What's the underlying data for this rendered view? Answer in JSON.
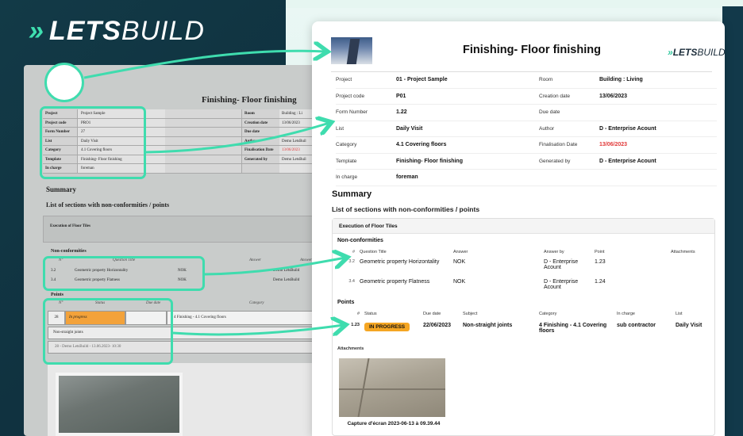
{
  "brand": {
    "chevrons": "»",
    "lets": "LETS",
    "build": "BUILD"
  },
  "old_doc": {
    "title": "Finishing- Floor finishing",
    "info_rows": [
      {
        "k": "Project",
        "v": "Project Sample",
        "k2": "Room",
        "v2": "Building : Li"
      },
      {
        "k": "Project code",
        "v": "PRO1",
        "k2": "Creation date",
        "v2": "13/06/2023"
      },
      {
        "k": "Form Number",
        "v": "27",
        "k2": "Due date",
        "v2": ""
      },
      {
        "k": "List",
        "v": "Daily Visit",
        "k2": "Author",
        "v2": "Demo LetsBuil"
      },
      {
        "k": "Category",
        "v": "4.1 Covering floors",
        "k2": "Finalisation Date",
        "v2": "13/06/2023"
      },
      {
        "k": "Template",
        "v": "Finishing- Floor finishing",
        "k2": "Generated by",
        "v2": "Demo LetsBuil"
      },
      {
        "k": "In charge",
        "v": "foreman",
        "k2": "",
        "v2": ""
      }
    ],
    "summary": "Summary",
    "list_heading": "List of sections with non-conformities / points",
    "section": "Execution of Floor Tiles",
    "nc_heading": "Non-conformities",
    "nc_cols": [
      "N°",
      "Question Title",
      "Answer",
      "Answer by"
    ],
    "nc_rows": [
      {
        "num": "3.2",
        "title": "Geometric property Horizontality",
        "answer": "NOK",
        "by": "Demo LetsBuild"
      },
      {
        "num": "3.4",
        "title": "Geometric property Flatness",
        "answer": "NOK",
        "by": "Demo LetsBuild"
      }
    ],
    "points_heading": "Points",
    "pt_cols": [
      "N°",
      "Status",
      "Due date",
      "Category"
    ],
    "pt_row": {
      "num": "28",
      "status": "In progress",
      "category": "4 Finishing - 4.1 Covering floors"
    },
    "subject": "Non-straight joints",
    "by_line": "28 - Demo LetsBuild - 13.06.2023- 10:30"
  },
  "new_doc": {
    "title": "Finishing- Floor finishing",
    "info_rows": [
      {
        "k": "Project",
        "v": "01 - Project Sample",
        "k2": "Room",
        "v2": "Building : Living"
      },
      {
        "k": "Project code",
        "v": "P01",
        "k2": "Creation date",
        "v2": "13/06/2023"
      },
      {
        "k": "Form Number",
        "v": "1.22",
        "k2": "Due date",
        "v2": ""
      },
      {
        "k": "List",
        "v": "Daily Visit",
        "k2": "Author",
        "v2": "D - Enterprise Acount"
      },
      {
        "k": "Category",
        "v": "4.1 Covering floors",
        "k2": "Finalisation Date",
        "v2": "13/06/2023"
      },
      {
        "k": "Template",
        "v": "Finishing- Floor finishing",
        "k2": "Generated by",
        "v2": "D - Enterprise Acount"
      },
      {
        "k": "In charge",
        "v": "foreman",
        "k2": "",
        "v2": ""
      }
    ],
    "summary": "Summary",
    "list_heading": "List of sections with non-conformities / points",
    "section": "Execution of Floor Tiles",
    "nc_heading": "Non-conformities",
    "nc_cols": [
      "#",
      "Question Title",
      "Answer",
      "Answer by",
      "Point",
      "Attachments"
    ],
    "nc_rows": [
      {
        "num": "3.2",
        "title": "Geometric property Horizontality",
        "answer": "NOK",
        "by": "D - Enterprise Acount",
        "point": "1.23"
      },
      {
        "num": "3.4",
        "title": "Geometric property Flatness",
        "answer": "NOK",
        "by": "D - Enterprise Acount",
        "point": "1.24"
      }
    ],
    "points_heading": "Points",
    "pt_cols": [
      "#",
      "Status",
      "Due date",
      "Subject",
      "Category",
      "In charge",
      "List"
    ],
    "pt_row": {
      "num": "1.23",
      "status": "IN PROGRESS",
      "due": "22/06/2023",
      "subject": "Non-straight joints",
      "category": "4 Finishing - 4.1 Covering floors",
      "in_charge": "sub contractor",
      "list": "Daily Visit"
    },
    "attachments": "Attachments",
    "caption": "Capture d'écran 2023-06-13 à 09.39.44"
  },
  "colors": {
    "accent": "#3fdcae",
    "dark": "#123a47",
    "status": "#f5a623",
    "red": "#e13838"
  }
}
